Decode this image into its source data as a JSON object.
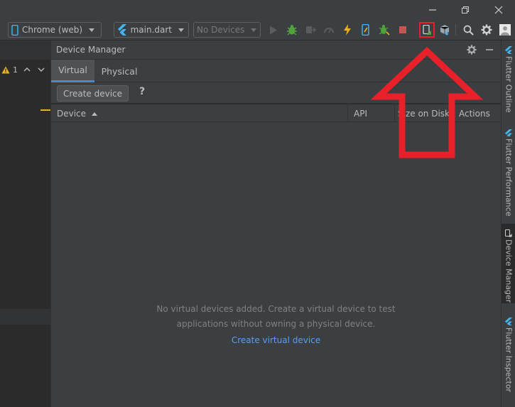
{
  "toolbar": {
    "target_device": "Chrome (web)",
    "run_config": "main.dart",
    "device_selector": "No Devices"
  },
  "editor": {
    "warning_count": "1"
  },
  "device_manager": {
    "title": "Device Manager",
    "tabs": [
      {
        "label": "Virtual",
        "selected": true
      },
      {
        "label": "Physical",
        "selected": false
      }
    ],
    "create_device_label": "Create device",
    "help_label": "?",
    "columns": {
      "device": "Device",
      "api": "API",
      "size_on_disk": "Size on Disk",
      "actions": "Actions"
    },
    "empty_line1": "No virtual devices added. Create a virtual device to test",
    "empty_line2": "applications without owning a physical device.",
    "create_link": "Create virtual device"
  },
  "right_sidebar": {
    "tabs": [
      {
        "label": "Flutter Outline",
        "active": false
      },
      {
        "label": "Flutter Performance",
        "active": false
      },
      {
        "label": "Device Manager",
        "active": true
      },
      {
        "label": "Flutter Inspector",
        "active": false
      }
    ]
  },
  "colors": {
    "accent": "#589df6",
    "highlight": "#e8202a",
    "flutter_blue": "#44b5f2",
    "warning": "#e9b120",
    "debug_green": "#4fa33a"
  }
}
